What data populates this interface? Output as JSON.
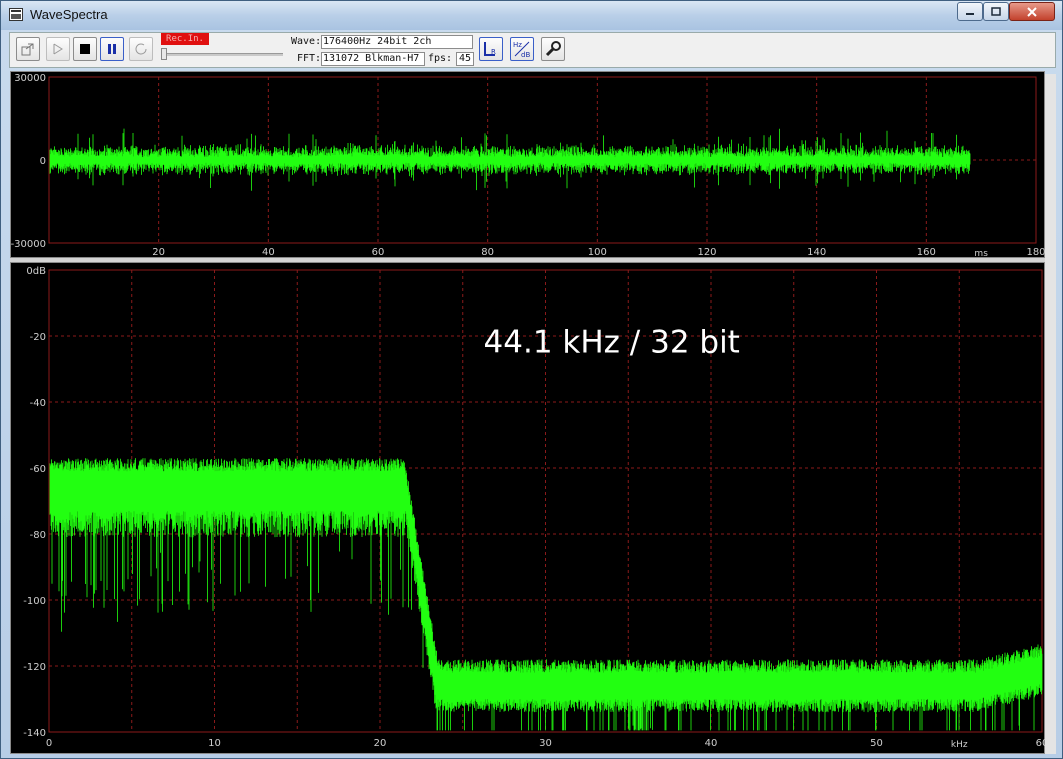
{
  "window": {
    "title": "WaveSpectra",
    "controls": [
      "minimize",
      "maximize",
      "close"
    ]
  },
  "toolbar": {
    "rec_badge": "Rec.In.",
    "wave_label": "Wave:",
    "wave_value": "176400Hz 24bit 2ch",
    "fft_label": "FFT:",
    "fft_value": "131072 Blkman-H7",
    "fps_label": "fps:",
    "fps_value": "45",
    "buttons": [
      {
        "icon": "open-file-icon"
      },
      {
        "icon": "play-icon"
      },
      {
        "icon": "stop-icon"
      },
      {
        "icon": "pause-icon"
      },
      {
        "icon": "loop-icon"
      },
      {
        "icon": "lr-channel-icon"
      },
      {
        "icon": "hz-db-scale-icon"
      },
      {
        "icon": "settings-wrench-icon"
      }
    ]
  },
  "colors": {
    "trace": "#22ff11",
    "grid": "#8b1a1a",
    "axis_text": "#cfcfcf",
    "background": "#000000"
  },
  "waveform": {
    "y_ticks": [
      "30000",
      "0",
      "-30000"
    ],
    "x_ticks": [
      "20",
      "40",
      "60",
      "80",
      "100",
      "120",
      "140",
      "160",
      "180"
    ],
    "x_unit": "ms",
    "x_range": [
      0,
      180
    ],
    "y_range": [
      -30000,
      30000
    ],
    "signal_end_ms": 168,
    "amplitude_typical": 5000
  },
  "spectrum": {
    "overlay_text": "44.1 kHz / 32 bit",
    "y_ticks": [
      "0dB",
      "-20",
      "-40",
      "-60",
      "-80",
      "-100",
      "-120",
      "-140"
    ],
    "x_ticks": [
      "0",
      "10",
      "20",
      "30",
      "40",
      "50",
      "60"
    ],
    "x_unit": "kHz",
    "x_range": [
      0,
      60
    ],
    "y_range": [
      -140,
      0
    ],
    "passband_level_db": -65,
    "cutoff_khz": 21.5,
    "stopband_khz": 23.5,
    "noise_floor_db": -126
  }
}
